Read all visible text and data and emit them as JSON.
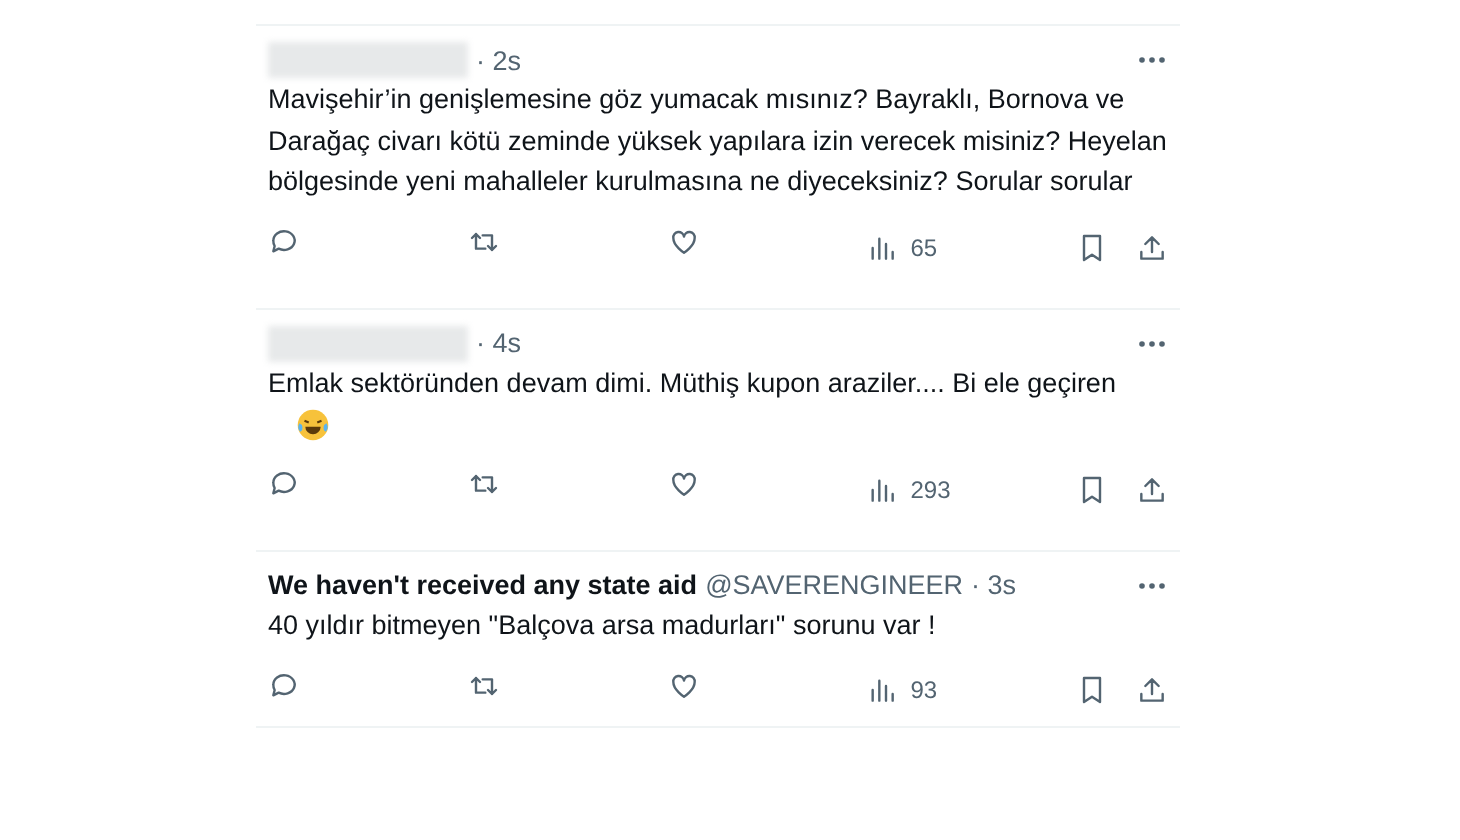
{
  "tweets": [
    {
      "author": {
        "redacted": true
      },
      "time": "· 2s",
      "text": "Mavişehir’in genişlemesine göz yumacak mısınız? Bayraklı, Bornova ve Darağaç civarı kötü zeminde yüksek yapılara izin verecek misiniz? Heyelan bölgesinde yeni mahalleler kurulmasına ne diyeceksiniz? Sorular sorular",
      "emoji": false,
      "views": "65"
    },
    {
      "author": {
        "redacted": true
      },
      "time": "· 4s",
      "text": "Emlak sektöründen devam dimi. Müthiş kupon araziler.... Bi ele geçiren",
      "emoji": true,
      "views": "293"
    },
    {
      "author": {
        "redacted": false,
        "name": "We haven't received any state aid",
        "handle": "@SAVERENGINEER"
      },
      "time": "· 3s",
      "text": "40 yıldır bitmeyen \"Balçova arsa madurları\" sorunu var !",
      "emoji": false,
      "views": "93"
    }
  ]
}
